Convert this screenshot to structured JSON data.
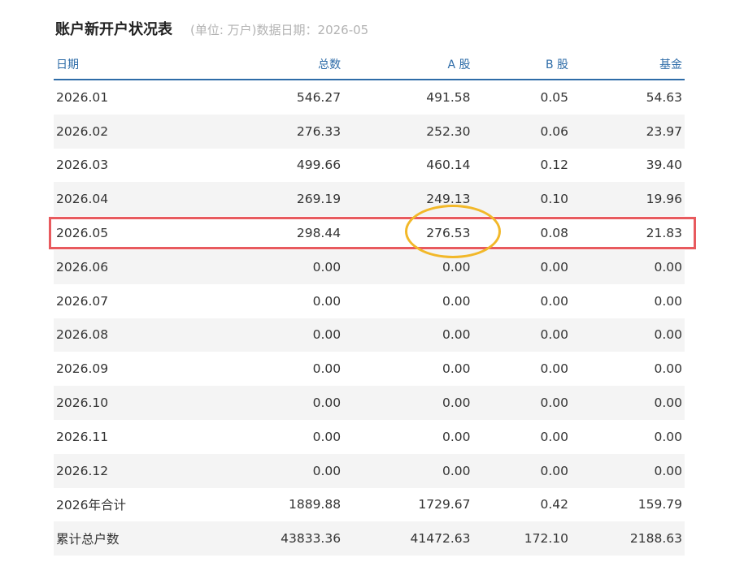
{
  "title": "账户新开户状况表",
  "subtitle": "(单位: 万户)数据日期：2026-05",
  "headers": {
    "date": "日期",
    "total": "总数",
    "a_share": "A 股",
    "b_share": "B 股",
    "fund": "基金"
  },
  "rows": [
    {
      "date": "2026.01",
      "total": "546.27",
      "a": "491.58",
      "b": "0.05",
      "fund": "54.63"
    },
    {
      "date": "2026.02",
      "total": "276.33",
      "a": "252.30",
      "b": "0.06",
      "fund": "23.97"
    },
    {
      "date": "2026.03",
      "total": "499.66",
      "a": "460.14",
      "b": "0.12",
      "fund": "39.40"
    },
    {
      "date": "2026.04",
      "total": "269.19",
      "a": "249.13",
      "b": "0.10",
      "fund": "19.96"
    },
    {
      "date": "2026.05",
      "total": "298.44",
      "a": "276.53",
      "b": "0.08",
      "fund": "21.83"
    },
    {
      "date": "2026.06",
      "total": "0.00",
      "a": "0.00",
      "b": "0.00",
      "fund": "0.00"
    },
    {
      "date": "2026.07",
      "total": "0.00",
      "a": "0.00",
      "b": "0.00",
      "fund": "0.00"
    },
    {
      "date": "2026.08",
      "total": "0.00",
      "a": "0.00",
      "b": "0.00",
      "fund": "0.00"
    },
    {
      "date": "2026.09",
      "total": "0.00",
      "a": "0.00",
      "b": "0.00",
      "fund": "0.00"
    },
    {
      "date": "2026.10",
      "total": "0.00",
      "a": "0.00",
      "b": "0.00",
      "fund": "0.00"
    },
    {
      "date": "2026.11",
      "total": "0.00",
      "a": "0.00",
      "b": "0.00",
      "fund": "0.00"
    },
    {
      "date": "2026.12",
      "total": "0.00",
      "a": "0.00",
      "b": "0.00",
      "fund": "0.00"
    },
    {
      "date": "2026年合计",
      "total": "1889.88",
      "a": "1729.67",
      "b": "0.42",
      "fund": "159.79"
    },
    {
      "date": "累计总户数",
      "total": "43833.36",
      "a": "41472.63",
      "b": "172.10",
      "fund": "2188.63"
    }
  ],
  "annotations": {
    "row_box_color": "#e85a5e",
    "ellipse_color": "#f2b829"
  },
  "colors": {
    "header_text": "#2e6ca8",
    "stripe": "#f4f4f4"
  }
}
